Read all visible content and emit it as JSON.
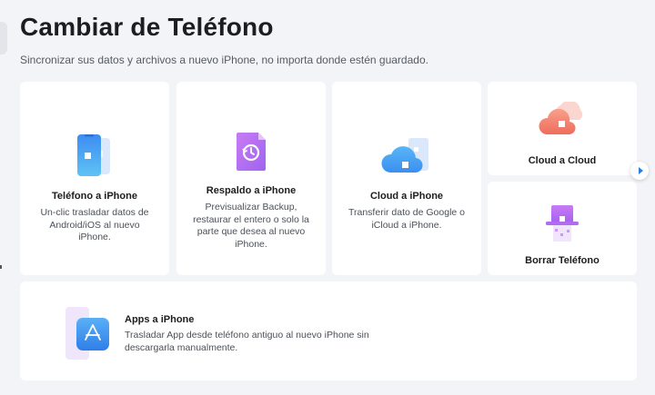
{
  "header": {
    "title": "Cambiar de Teléfono",
    "subtitle": "Sincronizar sus datos y archivos a nuevo iPhone, no importa donde estén guardado."
  },
  "cards": {
    "telefono": {
      "title": "Teléfono a iPhone",
      "desc": "Un-clic trasladar datos de Android/iOS al nuevo iPhone.",
      "icon": "phone-transfer-icon"
    },
    "respaldo": {
      "title": "Respaldo a iPhone",
      "desc": "Previsualizar Backup, restaurar el entero o solo la parte que desea al nuevo iPhone.",
      "icon": "backup-restore-icon"
    },
    "cloud": {
      "title": "Cloud a iPhone",
      "desc": "Transferir dato de Google o iCloud a iPhone.",
      "icon": "cloud-phone-icon"
    },
    "cloudcloud": {
      "title": "Cloud a Cloud",
      "icon": "cloud-cloud-icon"
    },
    "borrar": {
      "title": "Borrar Teléfono",
      "icon": "eraser-phone-icon"
    },
    "apps": {
      "title": "Apps a iPhone",
      "desc": "Trasladar App desde teléfono antiguo al nuevo iPhone sin descargarla manualmente.",
      "icon": "app-store-icon"
    }
  },
  "colors": {
    "accent_blue": "#2a7de1",
    "purple": "#b86ef0",
    "coral": "#f47f6c"
  }
}
